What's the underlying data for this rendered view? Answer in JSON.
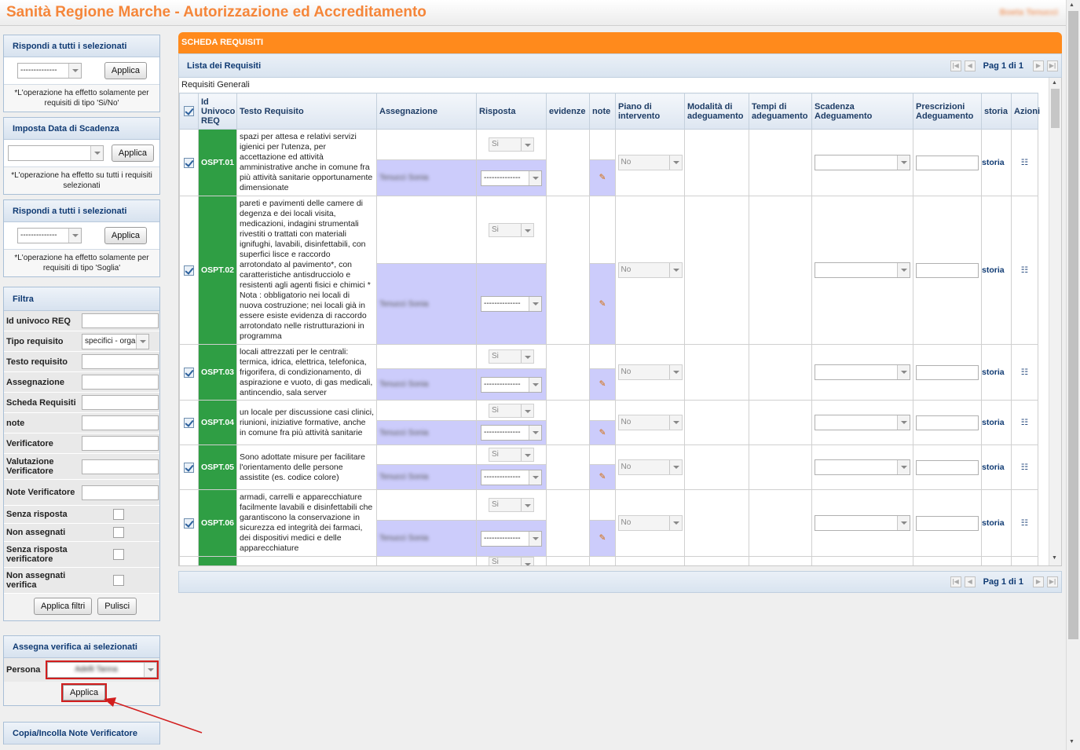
{
  "header": {
    "app_title": "Sanità Regione Marche - Autorizzazione ed Accreditamento",
    "user_name": "Boeta Tenucci"
  },
  "sidebar": {
    "rispondi1": {
      "title": "Rispondi a tutti i selezionati",
      "select_value": "--------------",
      "apply": "Applica",
      "note": "*L'operazione ha effetto solamente per requisiti di tipo 'Si/No'"
    },
    "scadenza": {
      "title": "Imposta Data di Scadenza",
      "select_value": "",
      "apply": "Applica",
      "note": "*L'operazione ha effetto su tutti i requisiti selezionati"
    },
    "rispondi2": {
      "title": "Rispondi a tutti i selezionati",
      "select_value": "--------------",
      "apply": "Applica",
      "note": "*L'operazione ha effetto solamente per requisiti di tipo 'Soglia'"
    },
    "filtra": {
      "title": "Filtra",
      "fields": {
        "id_univoco": "Id univoco REQ",
        "tipo": "Tipo requisito",
        "tipo_value": "specifici - orga",
        "testo": "Testo requisito",
        "assegnazione": "Assegnazione",
        "scheda": "Scheda Requisiti",
        "note": "note",
        "verificatore": "Verificatore",
        "valutazione": "Valutazione Verificatore",
        "note_verif": "Note Verificatore",
        "senza_risposta": "Senza risposta",
        "non_assegnati": "Non assegnati",
        "senza_risposta_verif": "Senza risposta verificatore",
        "non_assegnati_verif": "Non assegnati verifica"
      },
      "apply": "Applica filtri",
      "clear": "Pulisci"
    },
    "assegna": {
      "title": "Assegna verifica ai selezionati",
      "persona_label": "Persona",
      "persona_value": "Adelli Tanna",
      "apply": "Applica"
    },
    "copia": {
      "title": "Copia/Incolla Note Verificatore"
    }
  },
  "main": {
    "section_title": "SCHEDA REQUISITI",
    "list_title": "Lista dei Requisiti",
    "pager": "Pag 1 di 1",
    "group_caption": "Requisiti Generali",
    "columns": {
      "id": "Id Univoco REQ",
      "testo": "Testo Requisito",
      "assegnazione": "Assegnazione",
      "risposta": "Risposta",
      "evidenze": "evidenze",
      "note": "note",
      "piano": "Piano di intervento",
      "modalita": "Modalità di adeguamento",
      "tempi": "Tempi di adeguamento",
      "scadenza": "Scadenza Adeguamento",
      "prescrizioni": "Prescrizioni Adeguamento",
      "storia": "storia",
      "azioni": "Azioni"
    },
    "rows": [
      {
        "id": "OSPT.01",
        "text": "spazi per attesa e relativi servizi igienici per l'utenza, per accettazione ed attività amministrative anche in comune fra più attività sanitarie opportunamente dimensionate",
        "assegnato": "Tenucci Sonia",
        "risposta_top": "Si",
        "risposta_bottom": "--------------",
        "piano": "No",
        "storia": "storia"
      },
      {
        "id": "OSPT.02",
        "text": "pareti e pavimenti delle camere di degenza e dei locali visita, medicazioni, indagini strumentali rivestiti o trattati con materiali ignifughi, lavabili, disinfettabili, con superfici lisce e raccordo arrotondato al pavimento*, con caratteristiche antisdrucciolo e resistenti agli agenti fisici e chimici * Nota : obbligatorio nei locali di nuova costruzione; nei locali già in essere esiste evidenza di raccordo arrotondato nelle ristrutturazioni in programma",
        "assegnato": "Tenucci Sonia",
        "risposta_top": "Si",
        "risposta_bottom": "--------------",
        "piano": "No",
        "storia": "storia"
      },
      {
        "id": "OSPT.03",
        "text": "locali attrezzati per le centrali: termica, idrica, elettrica, telefonica, frigorifera, di condizionamento, di aspirazione e vuoto, di gas medicali, antincendio, sala server",
        "assegnato": "Tenucci Sonia",
        "risposta_top": "Si",
        "risposta_bottom": "--------------",
        "piano": "No",
        "storia": "storia"
      },
      {
        "id": "OSPT.04",
        "text": "un locale per discussione casi clinici, riunioni, iniziative formative, anche in comune fra più attività sanitarie",
        "assegnato": "Tenucci Sonia",
        "risposta_top": "Si",
        "risposta_bottom": "--------------",
        "piano": "No",
        "storia": "storia"
      },
      {
        "id": "OSPT.05",
        "text": "Sono adottate misure per facilitare l'orientamento delle persone assistite (es. codice colore)",
        "assegnato": "Tenucci Sonia",
        "risposta_top": "Si",
        "risposta_bottom": "--------------",
        "piano": "No",
        "storia": "storia"
      },
      {
        "id": "OSPT.06",
        "text": "armadi, carrelli e apparecchiature facilmente lavabili e disinfettabili che garantiscono la conservazione in sicurezza ed integrità dei farmaci, dei dispositivi medici e delle apparecchiature",
        "assegnato": "Tenucci Sonia",
        "risposta_top": "Si",
        "risposta_bottom": "--------------",
        "piano": "No",
        "storia": "storia"
      }
    ],
    "partial_row_risposta": "Si"
  }
}
